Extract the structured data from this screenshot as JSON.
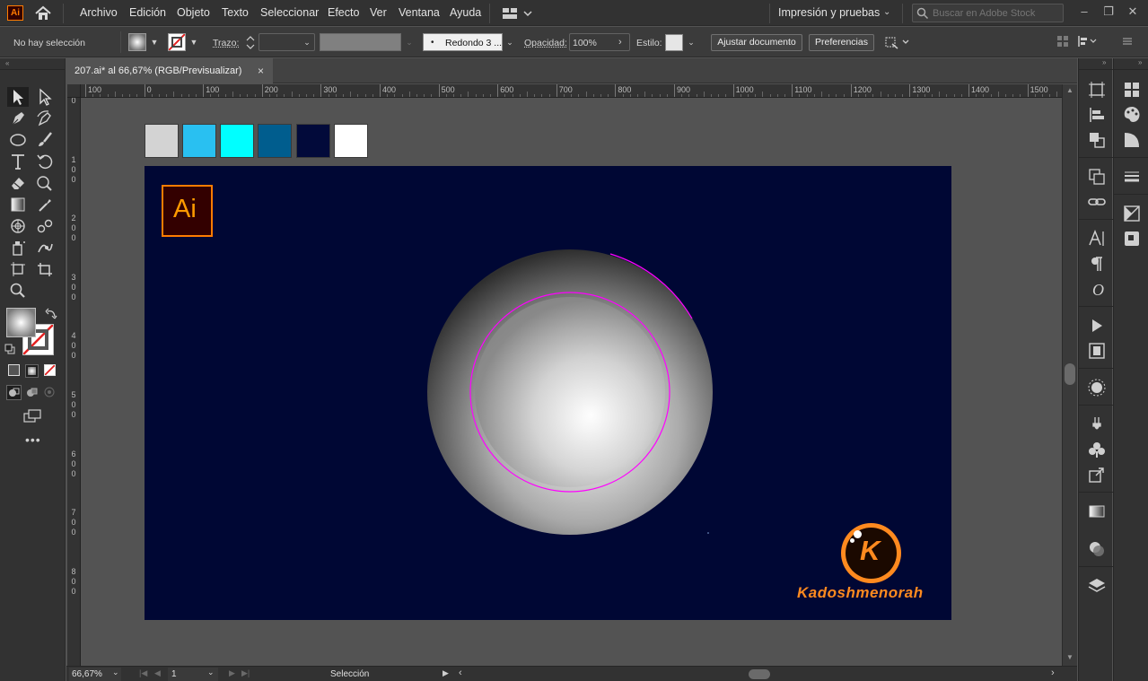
{
  "app": {
    "logo_text": "Ai",
    "home_icon": "home-icon"
  },
  "menu": {
    "items": [
      "Archivo",
      "Edición",
      "Objeto",
      "Texto",
      "Seleccionar",
      "Efecto",
      "Ver",
      "Ventana",
      "Ayuda"
    ],
    "workspace": "Impresión y pruebas",
    "search_placeholder": "Buscar en Adobe Stock"
  },
  "control": {
    "selection_status": "No hay selección",
    "stroke_label": "Trazo:",
    "brush": "Redondo 3 ...",
    "opacity_label": "Opacidad:",
    "opacity_value": "100%",
    "style_label": "Estilo:",
    "fit_button": "Ajustar documento",
    "prefs_button": "Preferencias"
  },
  "document": {
    "tab_title": "207.ai* al 66,67% (RGB/Previsualizar)",
    "tab_close": "×"
  },
  "ruler": {
    "top": [
      "100",
      "0",
      "100",
      "200",
      "300",
      "400",
      "500",
      "600",
      "700",
      "800",
      "900",
      "1000",
      "1100",
      "1200",
      "1300",
      "1400",
      "1500"
    ],
    "left": [
      "0",
      "100",
      "200",
      "300",
      "400",
      "500",
      "600",
      "700",
      "800"
    ]
  },
  "swatches": [
    "#d3d3d3",
    "#29c0f1",
    "#00ffff",
    "#005d8e",
    "#020a3a",
    "#ffffff"
  ],
  "artwork": {
    "artboard_color": "#000734",
    "ai_badge_text": "Ai",
    "brand_initial": "K",
    "brand_name": "Kadoshmenorah",
    "accent": "#ff8a1f",
    "guide_color": "#ff00ff"
  },
  "status": {
    "zoom": "66,67%",
    "artboard_num": "1",
    "tool_name": "Selección"
  }
}
